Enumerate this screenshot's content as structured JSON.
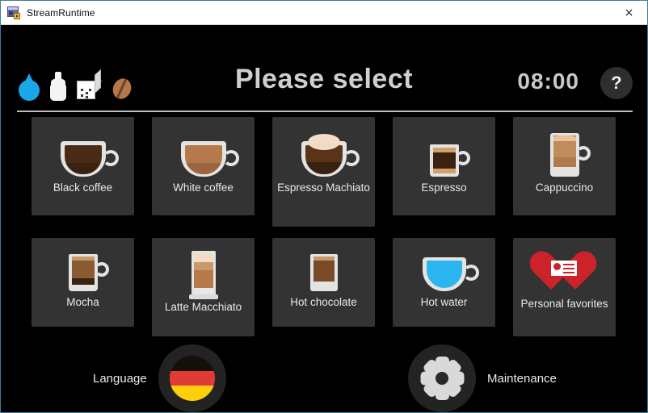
{
  "window": {
    "title": "StreamRuntime",
    "app_icon": "stream-runtime-icon",
    "close_label": "×"
  },
  "header": {
    "title": "Please select",
    "time": "08:00",
    "help_label": "?",
    "status_icons": [
      {
        "name": "water-drop-icon",
        "color": "#1aa7ea"
      },
      {
        "name": "milk-bottle-icon",
        "color": "#f4f4f2"
      },
      {
        "name": "sugar-cube-icon",
        "color": "#ffffff"
      },
      {
        "name": "coffee-bean-icon",
        "color": "#b5764a"
      }
    ]
  },
  "drinks": {
    "row1": [
      {
        "label": "Black coffee",
        "icon": "black-coffee-cup-icon",
        "style": "mug",
        "liquid": "#4a2c16",
        "liquid2": "#3a2110",
        "foam": false
      },
      {
        "label": "White coffee",
        "icon": "white-coffee-cup-icon",
        "style": "mug",
        "liquid": "#b5794c",
        "liquid2": "#9c6440",
        "foam": false
      },
      {
        "label": "Espresso Machiato",
        "icon": "espresso-machiato-cup-icon",
        "style": "mug",
        "liquid": "#5a3318",
        "liquid2": "#3a2110",
        "foam": true
      },
      {
        "label": "Espresso",
        "icon": "espresso-glass-icon",
        "style": "glass-small",
        "liquid": "#d2a06a",
        "liquid2": "#3a2110",
        "foam": false
      },
      {
        "label": "Cappuccino",
        "icon": "cappuccino-glass-icon",
        "style": "glass-tall",
        "liquid": "#c08c5c",
        "liquid2": "#b07c4e",
        "foam": false
      }
    ],
    "row2": [
      {
        "label": "Mocha",
        "icon": "mocha-glass-icon",
        "style": "glass-handle",
        "liquid": "#8a5a33",
        "liquid2": "#3a2110",
        "foam": false
      },
      {
        "label": "Latte Macchiato",
        "icon": "latte-macchiato-glass-icon",
        "style": "glass-latte",
        "liquid": "#f2dcc6",
        "liquid2": "#b5794c",
        "foam": false
      },
      {
        "label": "Hot chocolate",
        "icon": "hot-chocolate-glass-icon",
        "style": "glass-taper",
        "liquid": "#7a4a28",
        "liquid2": "#6a3f22",
        "foam": false
      },
      {
        "label": "Hot water",
        "icon": "hot-water-cup-icon",
        "style": "mug",
        "liquid": "#2cb6f0",
        "liquid2": "#2cb6f0",
        "foam": false
      },
      {
        "label": "Personal favorites",
        "icon": "personal-favorites-heart-icon",
        "style": "heart",
        "liquid": "#cc2229",
        "liquid2": "#cc2229",
        "foam": false
      }
    ]
  },
  "bottom": {
    "language_label": "Language",
    "language_flag": "german-flag-icon",
    "flag_colors": [
      "#121008",
      "#e03c35",
      "#fdce0a"
    ],
    "maintenance_label": "Maintenance",
    "maintenance_icon": "gear-icon"
  },
  "colors": {
    "screen_bg": "#000000",
    "tile_bg": "#333333",
    "text": "#e8e8e8",
    "accent_blue": "#1aa7ea",
    "accent_red": "#cc2229",
    "window_border": "#3f7f93"
  }
}
